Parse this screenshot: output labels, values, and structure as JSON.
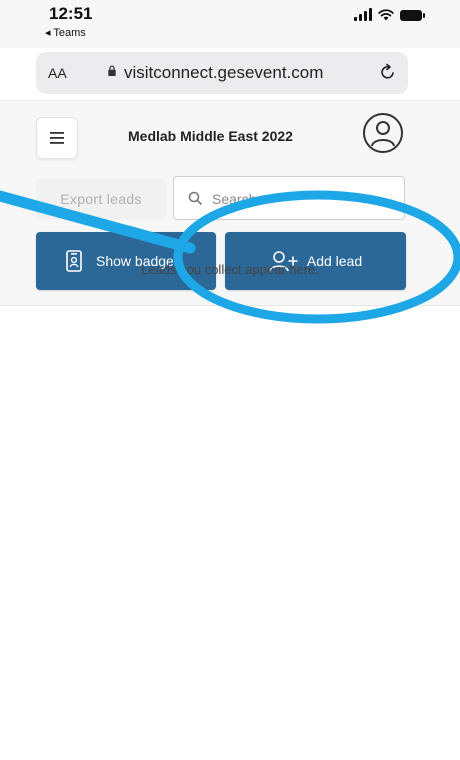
{
  "status_bar": {
    "time": "12:51",
    "back_app": "◂ Teams"
  },
  "browser": {
    "text_size_label": "AA",
    "url": "visitconnect.gesevent.com",
    "lock_icon": "lock-icon",
    "reload_icon": "reload-icon"
  },
  "header": {
    "menu_icon": "hamburger-icon",
    "title": "Medlab Middle East 2022",
    "avatar_icon": "user-icon"
  },
  "toolbar": {
    "export_label": "Export leads",
    "search_placeholder": "Search",
    "show_badge_label": "Show badge",
    "add_lead_label": "Add lead"
  },
  "main": {
    "empty_message": "Leads you collect appear here."
  },
  "colors": {
    "primary_button": "#2b6797",
    "annotation_highlight": "#1da7e6"
  }
}
